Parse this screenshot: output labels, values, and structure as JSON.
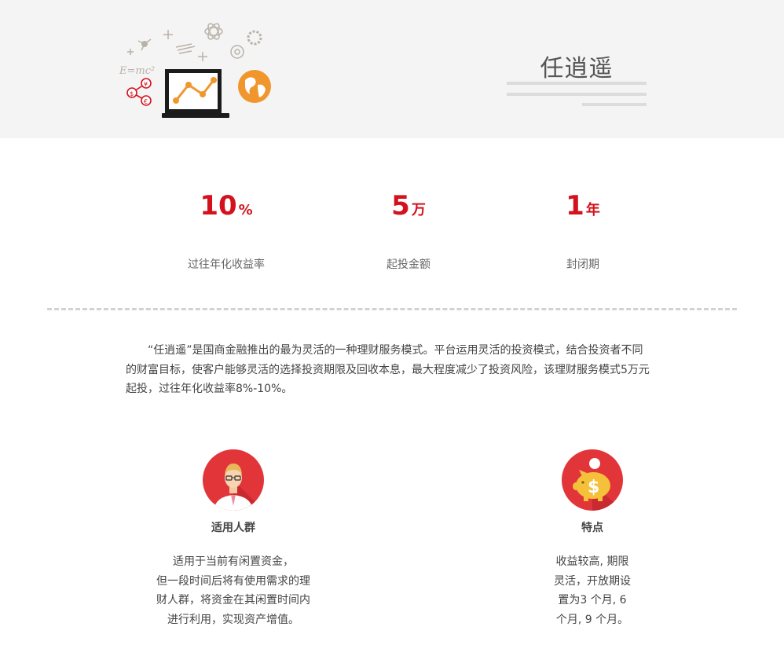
{
  "hero": {
    "title": "任逍遥",
    "illustration": "laptop-growth-chart-icon",
    "formula_text": "E=mc²"
  },
  "stats": [
    {
      "value": "10",
      "unit": "%",
      "label": "过往年化收益率"
    },
    {
      "value": "5",
      "unit": "万",
      "label": "起投金额"
    },
    {
      "value": "1",
      "unit": "年",
      "label": "封闭期"
    }
  ],
  "description": "“任逍遥”是国商金融推出的最为灵活的一种理财服务模式。平台运用灵活的投资模式，结合投资者不同的财富目标，使客户能够灵活的选择投资期限及回收本息，最大程度减少了投资风险，该理财服务模式5万元起投，过往年化收益率8%-10%。",
  "features": [
    {
      "icon": "businessman-avatar-icon",
      "title": "适用人群",
      "lines": [
        "适用于当前有闲置资金，",
        "但一段时间后将有使用需求的理",
        "财人群，将资金在其闲置时间内",
        "进行利用，实现资产增值。"
      ]
    },
    {
      "icon": "piggy-bank-dollar-icon",
      "title": "特点",
      "lines": [
        "收益较高, 期限",
        "灵活，开放期设",
        "置为3 个月, 6",
        "个月, 9 个月。"
      ]
    }
  ],
  "colors": {
    "accent": "#d4121e",
    "icon_red": "#e2353a",
    "orange": "#f0962d",
    "hero_bg": "#f4f4f4"
  }
}
